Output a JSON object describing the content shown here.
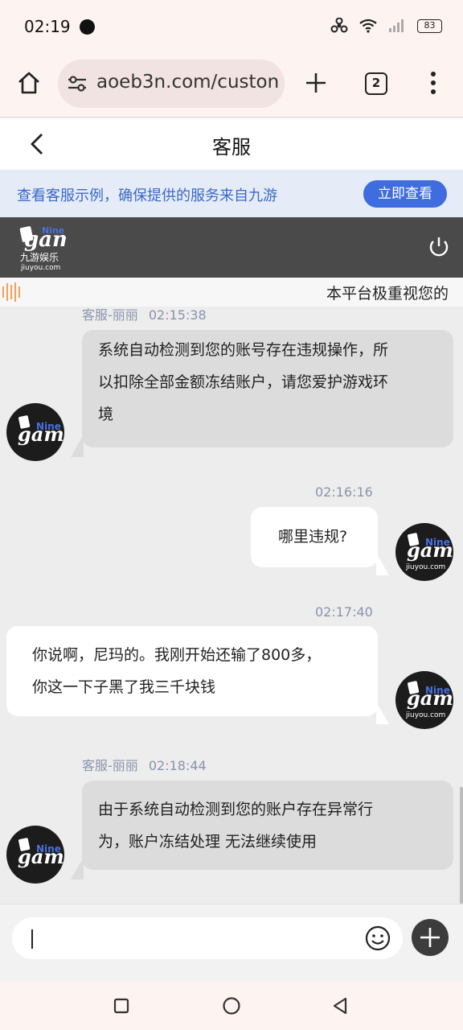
{
  "status": {
    "time": "02:19",
    "battery": "83"
  },
  "browser": {
    "url": "aoeb3n.com/custon",
    "tab_count": "2"
  },
  "header": {
    "title": "客服"
  },
  "notice": {
    "text": "查看客服示例，确保提供的服务来自九游",
    "button": "立即查看"
  },
  "brand": {
    "name_top": "Nine",
    "name_main": "game",
    "name_cn": "九游娱乐",
    "site": "jiuyou.com"
  },
  "marquee": {
    "text": "本平台极重视您的"
  },
  "messages": [
    {
      "side": "left",
      "sender": "客服-丽丽",
      "time": "02:15:38",
      "lines": [
        "系统自动检测到您的账号存在违规操作，所",
        "以扣除全部金额冻结账户，请您爱护游戏环",
        "境"
      ]
    },
    {
      "side": "right",
      "time": "02:16:16",
      "lines": [
        "哪里违规?"
      ]
    },
    {
      "side": "right",
      "time": "02:17:40",
      "lines": [
        "你说啊，尼玛的。我刚开始还输了800多，",
        "你这一下子黑了我三千块钱"
      ]
    },
    {
      "side": "left",
      "sender": "客服-丽丽",
      "time": "02:18:44",
      "lines": [
        "由于系统自动检测到您的账户存在异常行",
        "为，账户冻结处理 无法继续使用"
      ]
    }
  ],
  "colors": {
    "accent": "#3f6de0",
    "notice_bg": "#e5ecf7",
    "brand_bg": "#4a4a4a",
    "chat_bg": "#ededed"
  },
  "icons": [
    "home-icon",
    "site-settings-icon",
    "plus-icon",
    "tab-switcher-icon",
    "more-vert-icon",
    "back-icon",
    "power-icon",
    "audio-bars-icon",
    "emoji-icon",
    "add-icon",
    "nav-recent-icon",
    "nav-home-icon",
    "nav-back-icon"
  ]
}
